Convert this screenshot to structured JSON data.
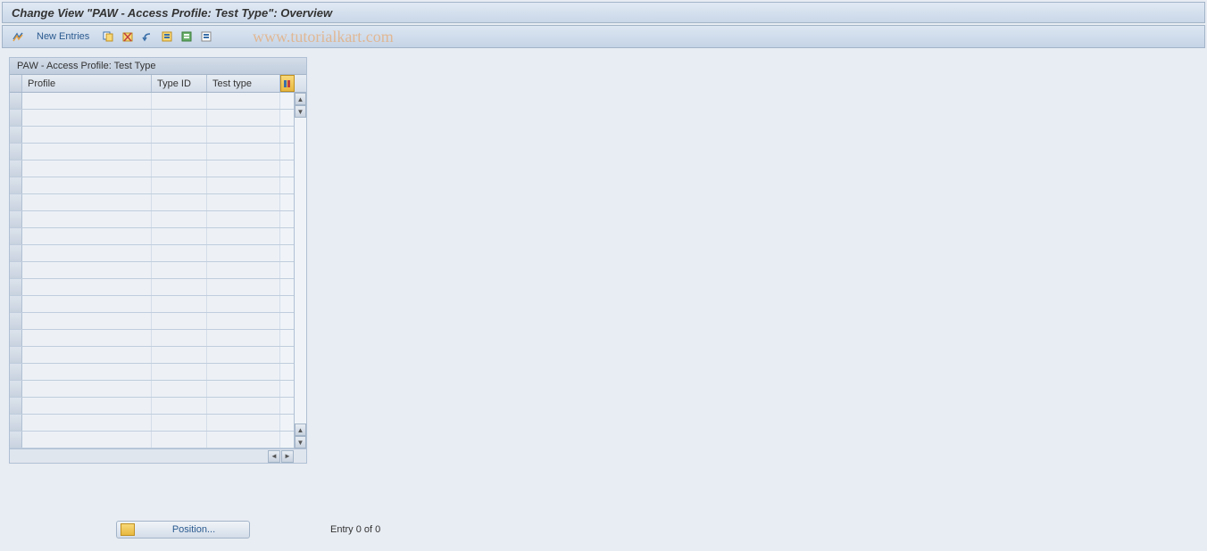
{
  "title": "Change View \"PAW - Access Profile: Test Type\": Overview",
  "toolbar": {
    "new_entries": "New Entries"
  },
  "watermark": "www.tutorialkart.com",
  "table": {
    "title": "PAW - Access Profile: Test Type",
    "columns": {
      "profile": "Profile",
      "typeid": "Type ID",
      "testtype": "Test type"
    },
    "row_count": 21
  },
  "footer": {
    "position_label": "Position...",
    "entry_text": "Entry 0 of 0"
  }
}
